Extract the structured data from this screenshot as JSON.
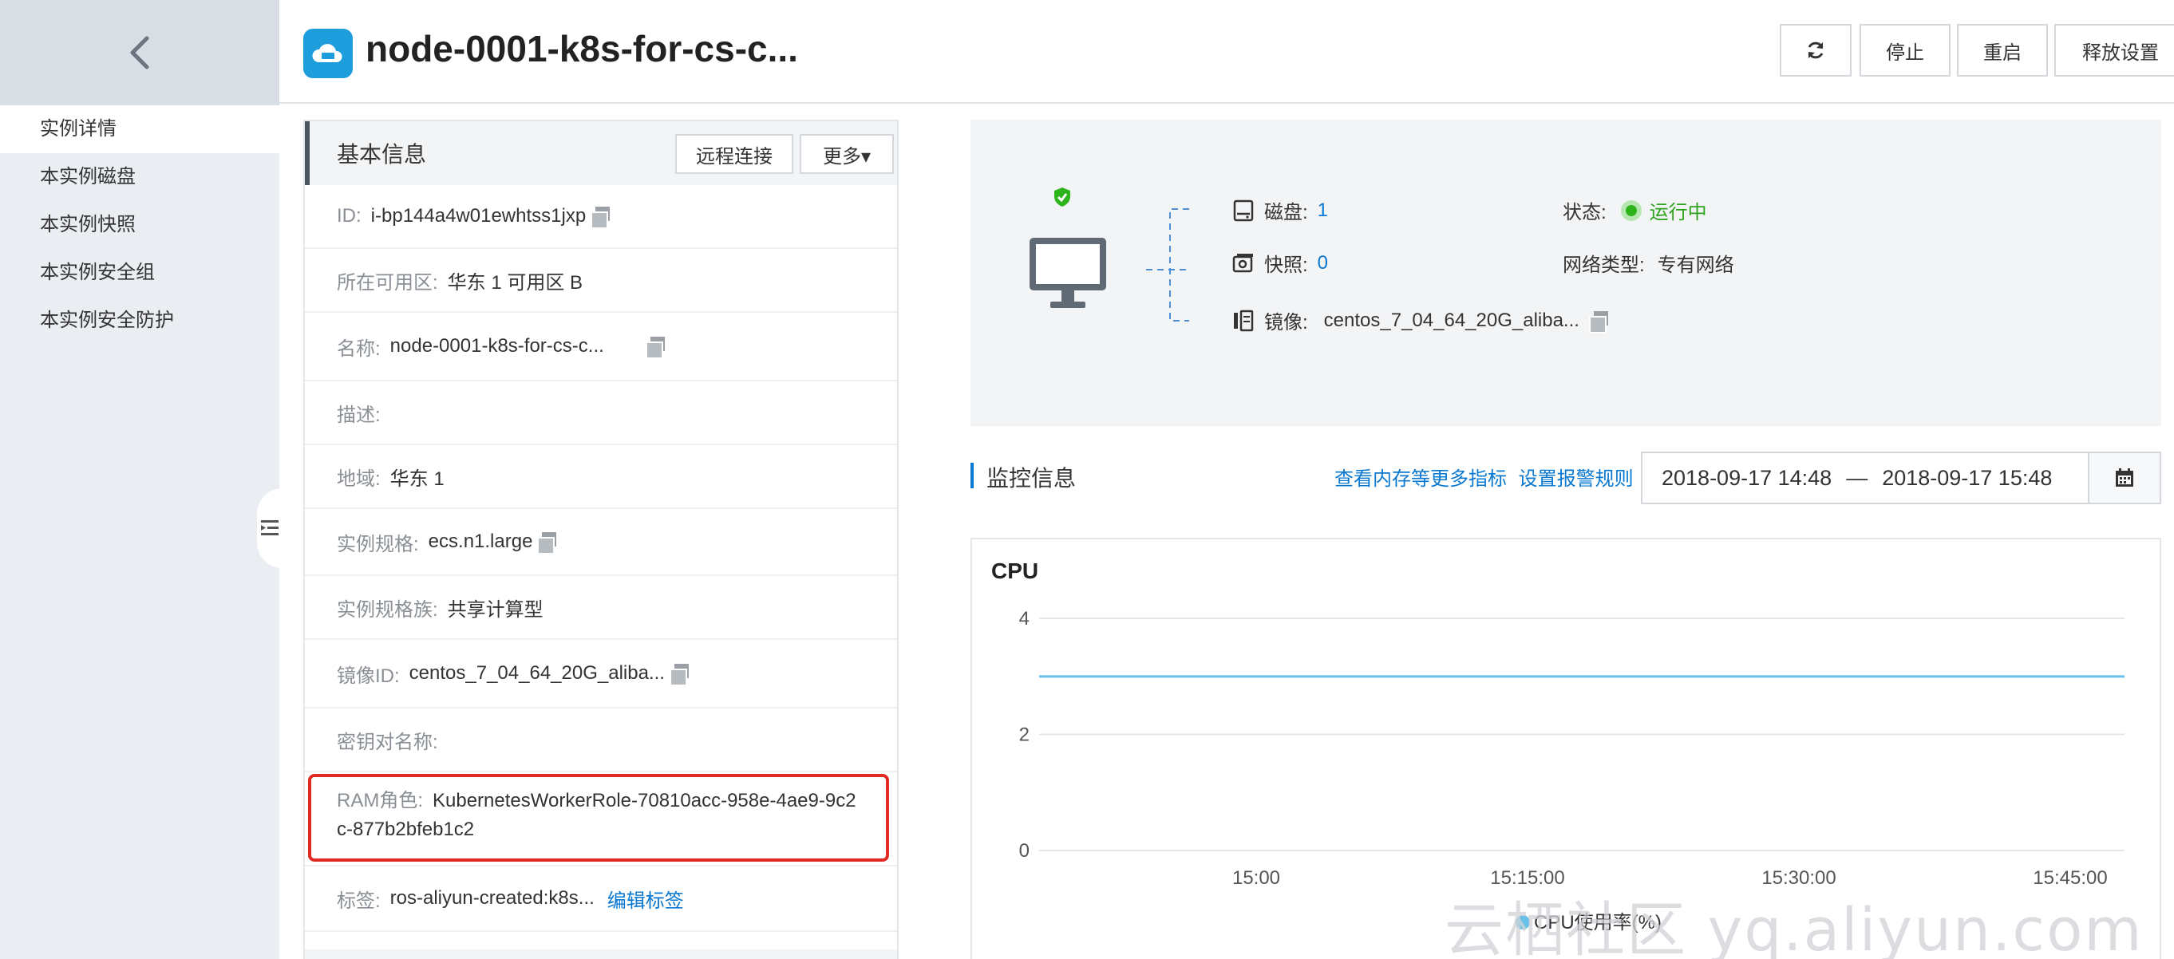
{
  "sidebar": {
    "items": [
      {
        "label": "实例详情"
      },
      {
        "label": "本实例磁盘"
      },
      {
        "label": "本实例快照"
      },
      {
        "label": "本实例安全组"
      },
      {
        "label": "本实例安全防护"
      }
    ]
  },
  "header": {
    "title": "node-0001-k8s-for-cs-c...",
    "stop": "停止",
    "restart": "重启",
    "release": "释放设置"
  },
  "basic_info": {
    "title": "基本信息",
    "remote_connect": "远程连接",
    "more": "更多▾",
    "rows": [
      {
        "label": "ID:",
        "value": "i-bp144a4w01ewhtss1jxp"
      },
      {
        "label": "所在可用区:",
        "value": "华东 1 可用区 B"
      },
      {
        "label": "名称:",
        "value": "node-0001-k8s-for-cs-c..."
      },
      {
        "label": "描述:",
        "value": ""
      },
      {
        "label": "地域:",
        "value": "华东 1"
      },
      {
        "label": "实例规格:",
        "value": "ecs.n1.large"
      },
      {
        "label": "实例规格族:",
        "value": "共享计算型"
      },
      {
        "label": "镜像ID:",
        "value": "centos_7_04_64_20G_aliba..."
      },
      {
        "label": "密钥对名称:",
        "value": ""
      },
      {
        "label": "RAM角色:",
        "value": "KubernetesWorkerRole-70810acc-958e-4ae9-9c2c-877b2bfeb1c2"
      },
      {
        "label": "标签:",
        "value": "ros-aliyun-created:k8s...",
        "link": "编辑标签"
      }
    ]
  },
  "overview": {
    "disk_label": "磁盘:",
    "disk_count": "1",
    "snapshot_label": "快照:",
    "snapshot_count": "0",
    "image_label": "镜像:",
    "image_value": "centos_7_04_64_20G_aliba...",
    "status_label": "状态:",
    "status_value": "运行中",
    "network_label": "网络类型:",
    "network_value": "专有网络",
    "status_color": "#2db31c"
  },
  "monitor": {
    "title": "监控信息",
    "link_more": "查看内存等更多指标",
    "link_alarm": "设置报警规则",
    "date_start": "2018-09-17 14:48",
    "date_sep": "—",
    "date_end": "2018-09-17 15:48"
  },
  "chart_data": {
    "type": "line",
    "title": "CPU",
    "x": [
      "14:48",
      "15:48"
    ],
    "x_ticks": [
      "15:00",
      "15:15:00",
      "15:30:00",
      "15:45:00"
    ],
    "y_ticks": [
      0,
      2,
      4
    ],
    "ylim": [
      0,
      4.4
    ],
    "series": [
      {
        "name": "CPU使用率(%)",
        "values": [
          3,
          3
        ],
        "color": "#67c1e8"
      }
    ],
    "legend": "bottom-center",
    "grid": true
  },
  "watermark": "云栖社区 yq.aliyun.com"
}
